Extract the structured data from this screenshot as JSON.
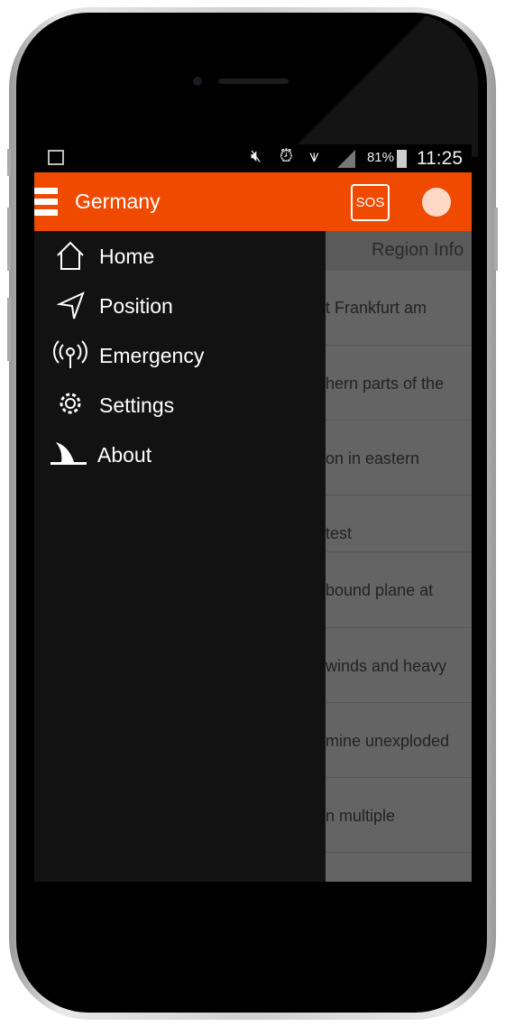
{
  "status_bar": {
    "battery": "81%",
    "time": "11:25",
    "icons": [
      "image-icon",
      "mute-icon",
      "alarm-icon",
      "wifi-icon",
      "signal-icon",
      "battery-icon"
    ]
  },
  "toolbar": {
    "title": "Germany",
    "sos_label": "SOS",
    "accent": "#f04a00"
  },
  "drawer": {
    "items": [
      {
        "label": "Home",
        "icon": "home-icon"
      },
      {
        "label": "Position",
        "icon": "navigation-icon"
      },
      {
        "label": "Emergency",
        "icon": "broadcast-icon"
      },
      {
        "label": "Settings",
        "icon": "gear-icon"
      },
      {
        "label": "About",
        "icon": "fin-icon"
      }
    ]
  },
  "content": {
    "header": "Region Info",
    "rows": [
      "t Frankfurt am",
      "hern parts of the",
      "on in eastern",
      "test",
      "bound plane at",
      "winds and heavy",
      "mine unexploded",
      "n multiple"
    ]
  }
}
